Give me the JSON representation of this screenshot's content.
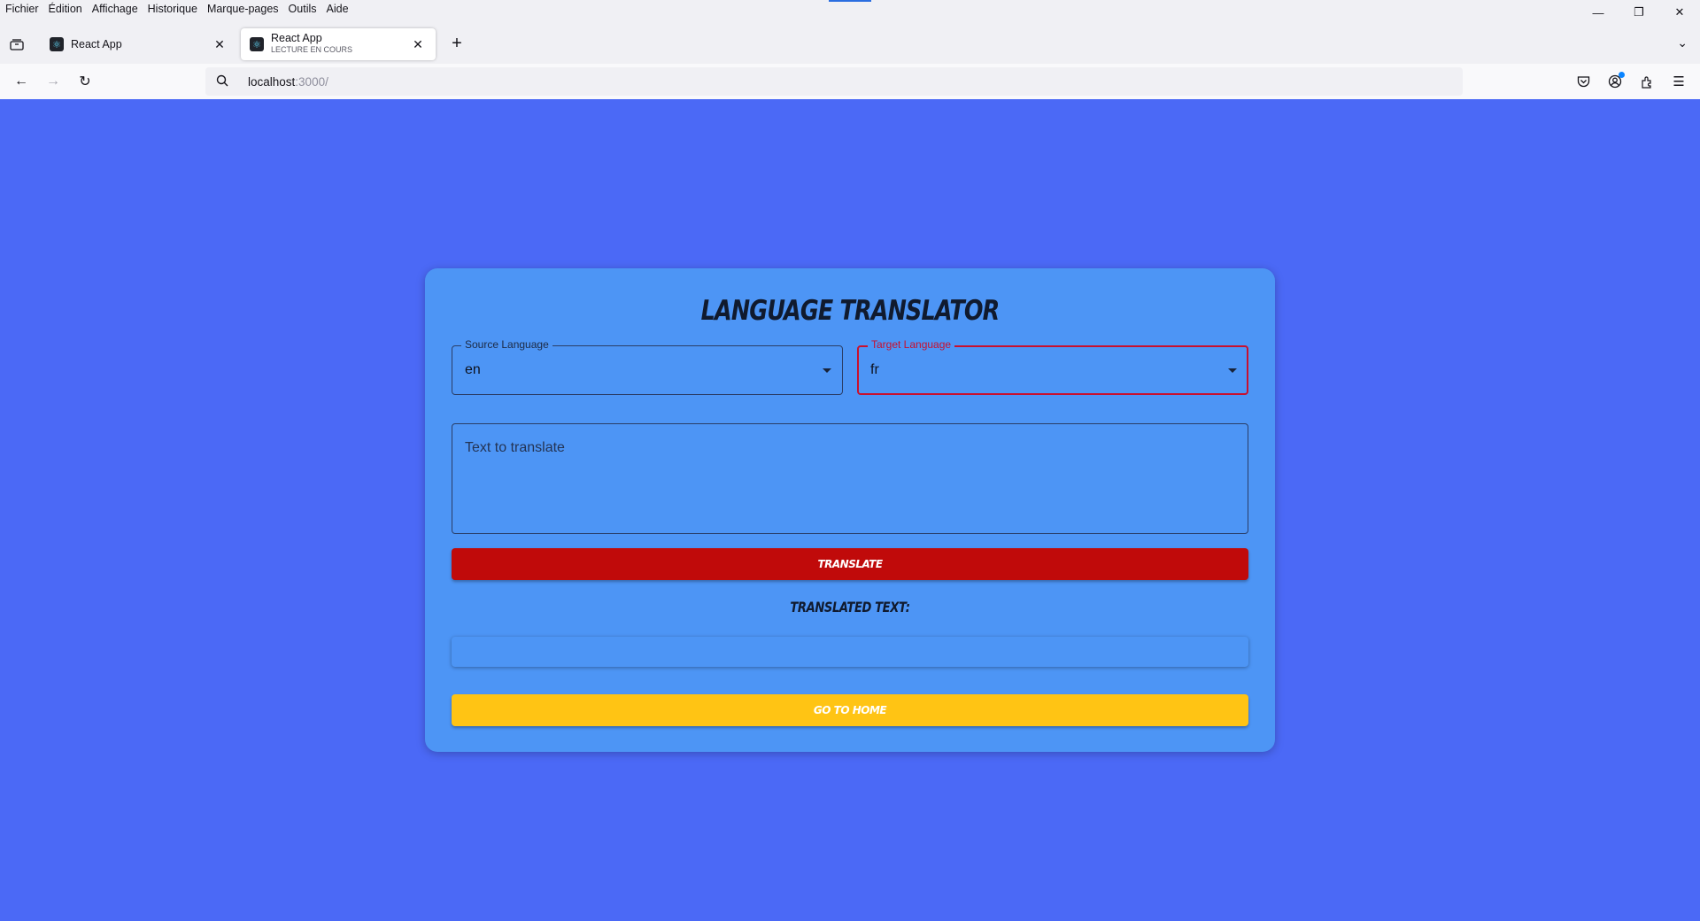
{
  "browser": {
    "menu": [
      "Fichier",
      "Édition",
      "Affichage",
      "Historique",
      "Marque-pages",
      "Outils",
      "Aide"
    ],
    "tabs": [
      {
        "title": "React App",
        "subtitle": ""
      },
      {
        "title": "React App",
        "subtitle": "LECTURE EN COURS"
      }
    ],
    "url": {
      "host": "localhost",
      "rest": ":3000/"
    }
  },
  "app": {
    "title": "Language Translator",
    "source_language": {
      "label": "Source Language",
      "value": "en"
    },
    "target_language": {
      "label": "Target Language",
      "value": "fr"
    },
    "text_placeholder": "Text to translate",
    "translate_label": "Translate",
    "result_label": "Translated Text:",
    "result_value": "",
    "home_label": "Go to Home"
  },
  "colors": {
    "page_background": "#4b69f6",
    "card_background": "#4d95f5",
    "translate_button": "#c00a0a",
    "home_button": "#ffc414",
    "error_outline": "#c8102e"
  }
}
